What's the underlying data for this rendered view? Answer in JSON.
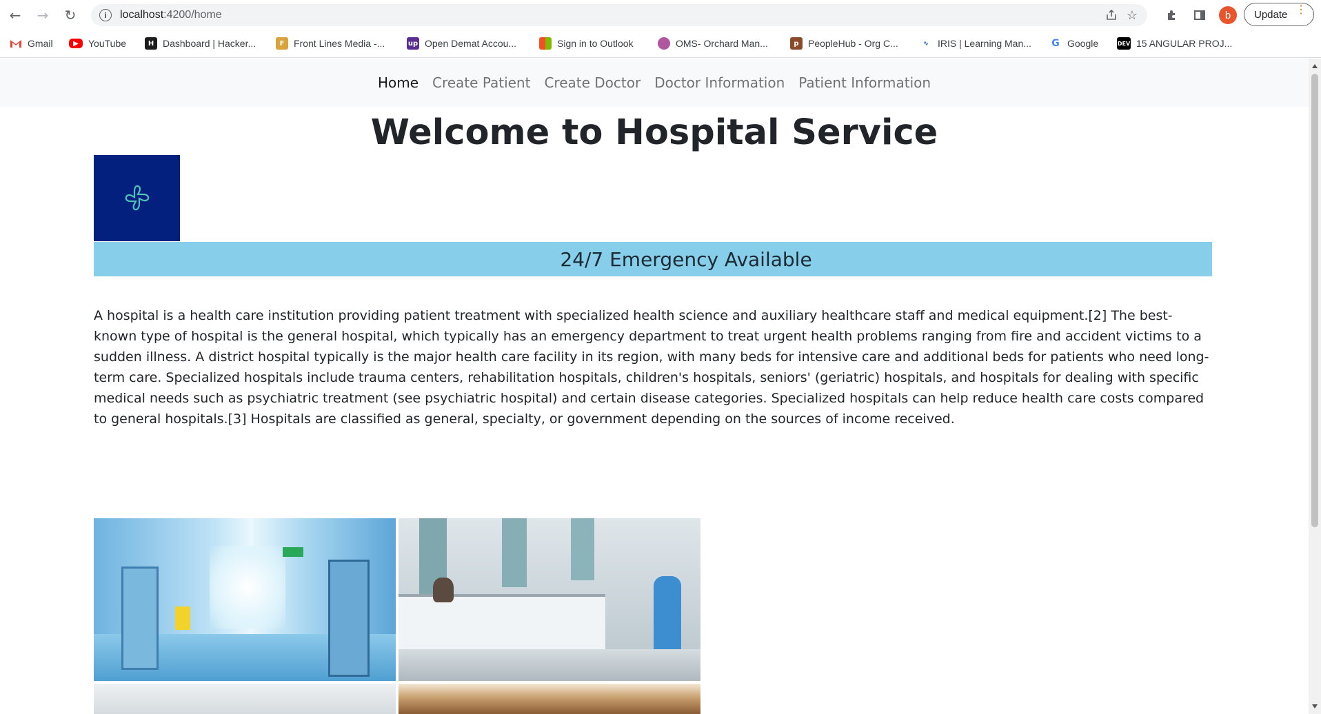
{
  "browser": {
    "url_host": "localhost",
    "url_path": ":4200/home",
    "avatar_letter": "b",
    "update_label": "Update",
    "bookmarks": [
      {
        "label": "Gmail",
        "icon": "gmail-icon",
        "color": "#ea4335"
      },
      {
        "label": "YouTube",
        "icon": "youtube-icon",
        "color": "#ff0000"
      },
      {
        "label": "Dashboard | Hacker...",
        "icon": "hackerrank-icon",
        "color": "#1c1c1c"
      },
      {
        "label": "Front Lines Media -...",
        "icon": "frontlines-icon",
        "color": "#d9a23a"
      },
      {
        "label": "Open Demat Accou...",
        "icon": "upstox-icon",
        "color": "#5a2d91"
      },
      {
        "label": "Sign in to Outlook",
        "icon": "microsoft-icon",
        "color": "#f25022"
      },
      {
        "label": "OMS- Orchard Man...",
        "icon": "orchard-icon",
        "color": "#b0569e"
      },
      {
        "label": "PeopleHub - Org C...",
        "icon": "peoplehub-icon",
        "color": "#8a4b2a"
      },
      {
        "label": "IRIS | Learning Man...",
        "icon": "iris-icon",
        "color": "#2a6fc9"
      },
      {
        "label": "Google",
        "icon": "google-icon",
        "color": "#4285f4"
      },
      {
        "label": "15 ANGULAR PROJ...",
        "icon": "dev-icon",
        "color": "#000000"
      }
    ]
  },
  "nav": {
    "items": [
      {
        "label": "Home",
        "active": true
      },
      {
        "label": "Create Patient",
        "active": false
      },
      {
        "label": "Create Doctor",
        "active": false
      },
      {
        "label": "Doctor Information",
        "active": false
      },
      {
        "label": "Patient Information",
        "active": false
      }
    ]
  },
  "page": {
    "title": "Welcome to Hospital Service",
    "logo_icon": "medical-cross-icon",
    "banner": "24/7 Emergency Available",
    "intro": "A hospital is a health care institution providing patient treatment with specialized health science and auxiliary healthcare staff and medical equipment.[2] The best-known type of hospital is the general hospital, which typically has an emergency department to treat urgent health problems ranging from fire and accident victims to a sudden illness. A district hospital typically is the major health care facility in its region, with many beds for intensive care and additional beds for patients who need long-term care. Specialized hospitals include trauma centers, rehabilitation hospitals, children's hospitals, seniors' (geriatric) hospitals, and hospitals for dealing with specific medical needs such as psychiatric treatment (see psychiatric hospital) and certain disease categories. Specialized hospitals can help reduce health care costs compared to general hospitals.[3] Hospitals are classified as general, specialty, or government depending on the sources of income received."
  },
  "colors": {
    "banner": "#87ceeb",
    "logo_bg": "#03207f",
    "navbar_bg": "#f8f9fa"
  }
}
